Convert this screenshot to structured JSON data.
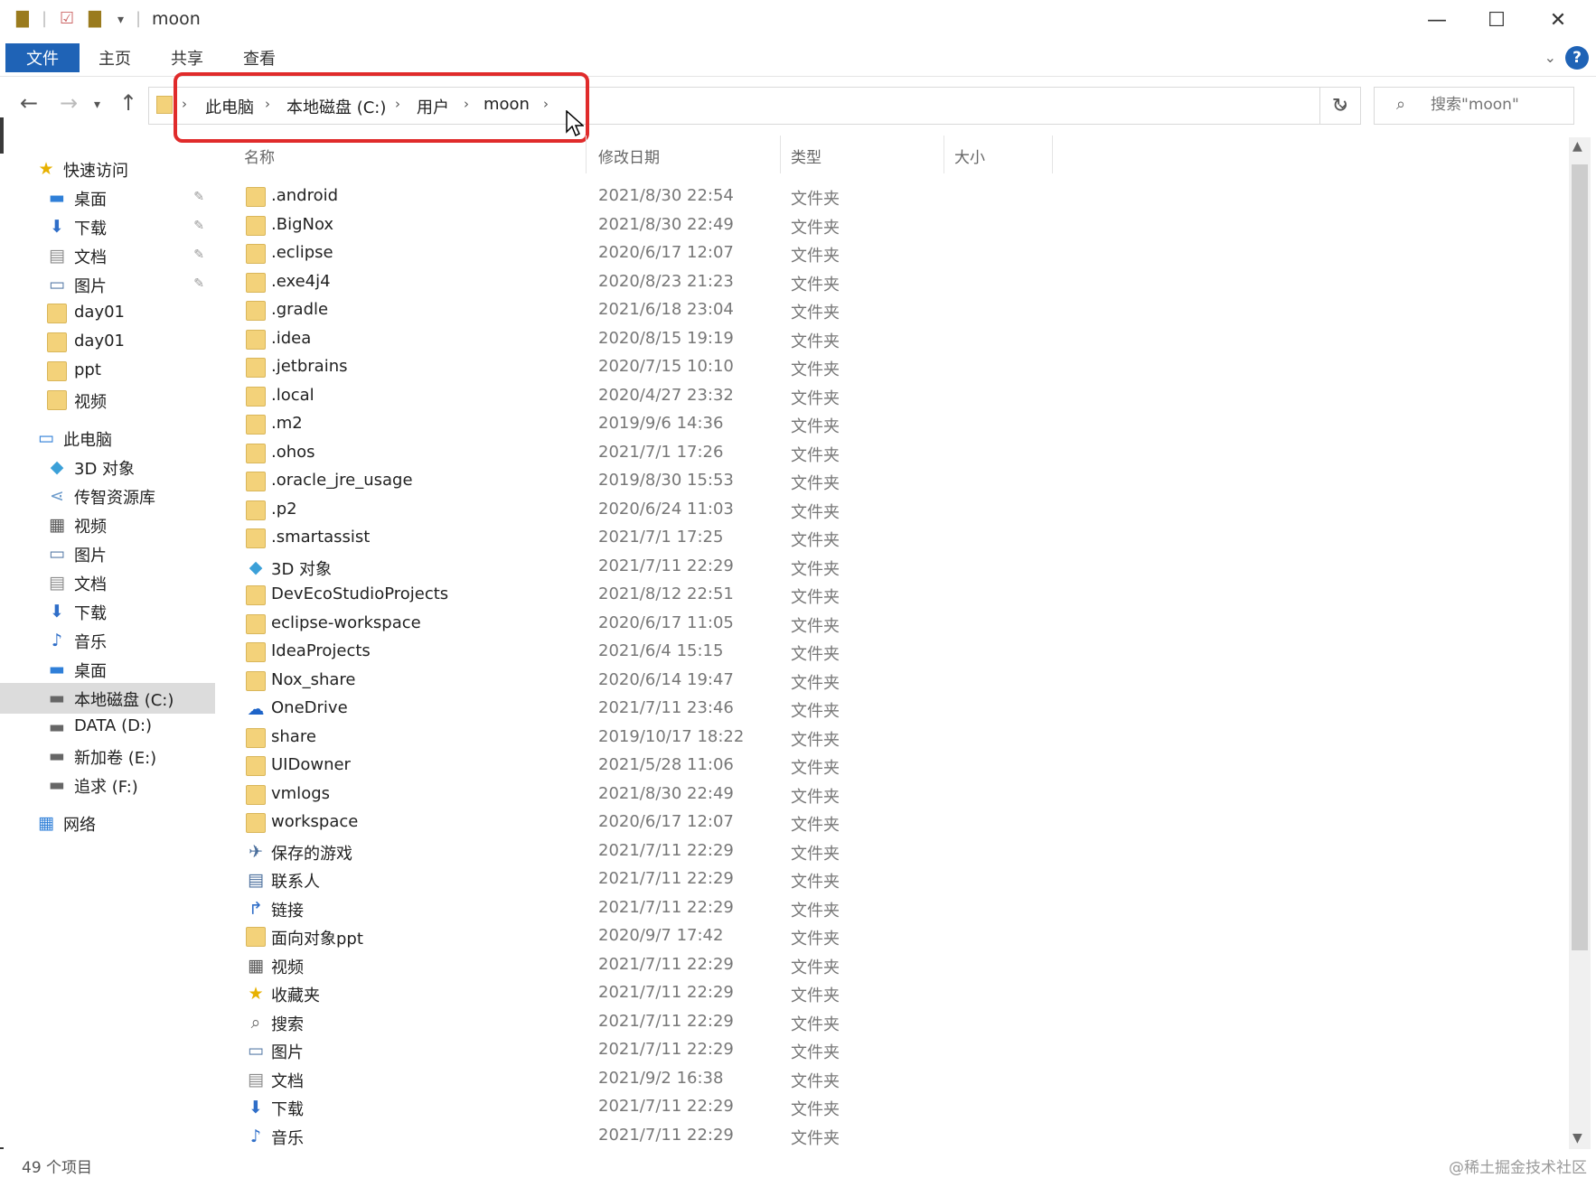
{
  "window": {
    "title": "moon"
  },
  "ribbon": {
    "tabs": [
      "文件",
      "主页",
      "共享",
      "查看"
    ],
    "help": "?"
  },
  "address": {
    "crumbs": [
      "此电脑",
      "本地磁盘 (C:)",
      "用户",
      "moon"
    ]
  },
  "search": {
    "placeholder": "搜索\"moon\""
  },
  "columns": {
    "name": "名称",
    "date": "修改日期",
    "type": "类型",
    "size": "大小"
  },
  "sidebar": {
    "items": [
      {
        "label": "快速访问",
        "icon": "star-icon",
        "indent": 0,
        "pinned": false
      },
      {
        "label": "桌面",
        "icon": "desktop-icon",
        "indent": 1,
        "pinned": true
      },
      {
        "label": "下载",
        "icon": "download-icon",
        "indent": 1,
        "pinned": true
      },
      {
        "label": "文档",
        "icon": "document-icon",
        "indent": 1,
        "pinned": true
      },
      {
        "label": "图片",
        "icon": "picture-icon",
        "indent": 1,
        "pinned": true
      },
      {
        "label": "day01",
        "icon": "folder-icon",
        "indent": 1,
        "pinned": false
      },
      {
        "label": "day01",
        "icon": "folder-icon",
        "indent": 1,
        "pinned": false
      },
      {
        "label": "ppt",
        "icon": "folder-icon",
        "indent": 1,
        "pinned": false
      },
      {
        "label": "视频",
        "icon": "folder-icon",
        "indent": 1,
        "pinned": false
      },
      {
        "label": "此电脑",
        "icon": "computer-icon",
        "indent": 0,
        "pinned": false
      },
      {
        "label": "3D 对象",
        "icon": "3d-objects-icon",
        "indent": 1,
        "pinned": false
      },
      {
        "label": "传智资源库",
        "icon": "share-icon",
        "indent": 1,
        "pinned": false
      },
      {
        "label": "视频",
        "icon": "video-icon",
        "indent": 1,
        "pinned": false
      },
      {
        "label": "图片",
        "icon": "picture-icon",
        "indent": 1,
        "pinned": false
      },
      {
        "label": "文档",
        "icon": "document-icon",
        "indent": 1,
        "pinned": false
      },
      {
        "label": "下载",
        "icon": "download-icon",
        "indent": 1,
        "pinned": false
      },
      {
        "label": "音乐",
        "icon": "music-icon",
        "indent": 1,
        "pinned": false
      },
      {
        "label": "桌面",
        "icon": "desktop-icon",
        "indent": 1,
        "pinned": false
      },
      {
        "label": "本地磁盘 (C:)",
        "icon": "drive-icon",
        "indent": 1,
        "pinned": false,
        "selected": true
      },
      {
        "label": "DATA (D:)",
        "icon": "drive-icon",
        "indent": 1,
        "pinned": false
      },
      {
        "label": "新加卷 (E:)",
        "icon": "drive-icon",
        "indent": 1,
        "pinned": false
      },
      {
        "label": "追求 (F:)",
        "icon": "drive-icon",
        "indent": 1,
        "pinned": false
      },
      {
        "label": "网络",
        "icon": "network-icon",
        "indent": 0,
        "pinned": false
      }
    ]
  },
  "files": [
    {
      "name": ".android",
      "date": "2021/8/30 22:54",
      "type": "文件夹",
      "icon": "folder-icon"
    },
    {
      "name": ".BigNox",
      "date": "2021/8/30 22:49",
      "type": "文件夹",
      "icon": "folder-icon"
    },
    {
      "name": ".eclipse",
      "date": "2020/6/17 12:07",
      "type": "文件夹",
      "icon": "folder-icon"
    },
    {
      "name": ".exe4j4",
      "date": "2020/8/23 21:23",
      "type": "文件夹",
      "icon": "folder-icon"
    },
    {
      "name": ".gradle",
      "date": "2021/6/18 23:04",
      "type": "文件夹",
      "icon": "folder-icon"
    },
    {
      "name": ".idea",
      "date": "2020/8/15 19:19",
      "type": "文件夹",
      "icon": "folder-icon"
    },
    {
      "name": ".jetbrains",
      "date": "2020/7/15 10:10",
      "type": "文件夹",
      "icon": "folder-icon"
    },
    {
      "name": ".local",
      "date": "2020/4/27 23:32",
      "type": "文件夹",
      "icon": "folder-icon"
    },
    {
      "name": ".m2",
      "date": "2019/9/6 14:36",
      "type": "文件夹",
      "icon": "folder-icon"
    },
    {
      "name": ".ohos",
      "date": "2021/7/1 17:26",
      "type": "文件夹",
      "icon": "folder-icon"
    },
    {
      "name": ".oracle_jre_usage",
      "date": "2019/8/30 15:53",
      "type": "文件夹",
      "icon": "folder-icon"
    },
    {
      "name": ".p2",
      "date": "2020/6/24 11:03",
      "type": "文件夹",
      "icon": "folder-icon"
    },
    {
      "name": ".smartassist",
      "date": "2021/7/1 17:25",
      "type": "文件夹",
      "icon": "folder-icon"
    },
    {
      "name": "3D 对象",
      "date": "2021/7/11 22:29",
      "type": "文件夹",
      "icon": "3d-objects-icon"
    },
    {
      "name": "DevEcoStudioProjects",
      "date": "2021/8/12 22:51",
      "type": "文件夹",
      "icon": "folder-icon"
    },
    {
      "name": "eclipse-workspace",
      "date": "2020/6/17 11:05",
      "type": "文件夹",
      "icon": "folder-icon"
    },
    {
      "name": "IdeaProjects",
      "date": "2021/6/4 15:15",
      "type": "文件夹",
      "icon": "folder-icon"
    },
    {
      "name": "Nox_share",
      "date": "2020/6/14 19:47",
      "type": "文件夹",
      "icon": "folder-icon"
    },
    {
      "name": "OneDrive",
      "date": "2021/7/11 23:46",
      "type": "文件夹",
      "icon": "cloud-icon"
    },
    {
      "name": "share",
      "date": "2019/10/17 18:22",
      "type": "文件夹",
      "icon": "folder-icon"
    },
    {
      "name": "UIDowner",
      "date": "2021/5/28 11:06",
      "type": "文件夹",
      "icon": "folder-icon"
    },
    {
      "name": "vmlogs",
      "date": "2021/8/30 22:49",
      "type": "文件夹",
      "icon": "folder-icon"
    },
    {
      "name": "workspace",
      "date": "2020/6/17 12:07",
      "type": "文件夹",
      "icon": "folder-icon"
    },
    {
      "name": "保存的游戏",
      "date": "2021/7/11 22:29",
      "type": "文件夹",
      "icon": "saved-games-icon"
    },
    {
      "name": "联系人",
      "date": "2021/7/11 22:29",
      "type": "文件夹",
      "icon": "contacts-icon"
    },
    {
      "name": "链接",
      "date": "2021/7/11 22:29",
      "type": "文件夹",
      "icon": "link-icon"
    },
    {
      "name": "面向对象ppt",
      "date": "2020/9/7 17:42",
      "type": "文件夹",
      "icon": "folder-icon"
    },
    {
      "name": "视频",
      "date": "2021/7/11 22:29",
      "type": "文件夹",
      "icon": "video-icon"
    },
    {
      "name": "收藏夹",
      "date": "2021/7/11 22:29",
      "type": "文件夹",
      "icon": "star-icon"
    },
    {
      "name": "搜索",
      "date": "2021/7/11 22:29",
      "type": "文件夹",
      "icon": "search-icon"
    },
    {
      "name": "图片",
      "date": "2021/7/11 22:29",
      "type": "文件夹",
      "icon": "picture-icon"
    },
    {
      "name": "文档",
      "date": "2021/9/2 16:38",
      "type": "文件夹",
      "icon": "document-icon"
    },
    {
      "name": "下载",
      "date": "2021/7/11 22:29",
      "type": "文件夹",
      "icon": "download-icon"
    },
    {
      "name": "音乐",
      "date": "2021/7/11 22:29",
      "type": "文件夹",
      "icon": "music-icon"
    }
  ],
  "status": {
    "count": "49 个项目"
  },
  "watermark": "@稀土掘金技术社区",
  "colors": {
    "accent": "#1f63b6",
    "highlight": "#e02b2b",
    "folder": "#f3d27a"
  }
}
